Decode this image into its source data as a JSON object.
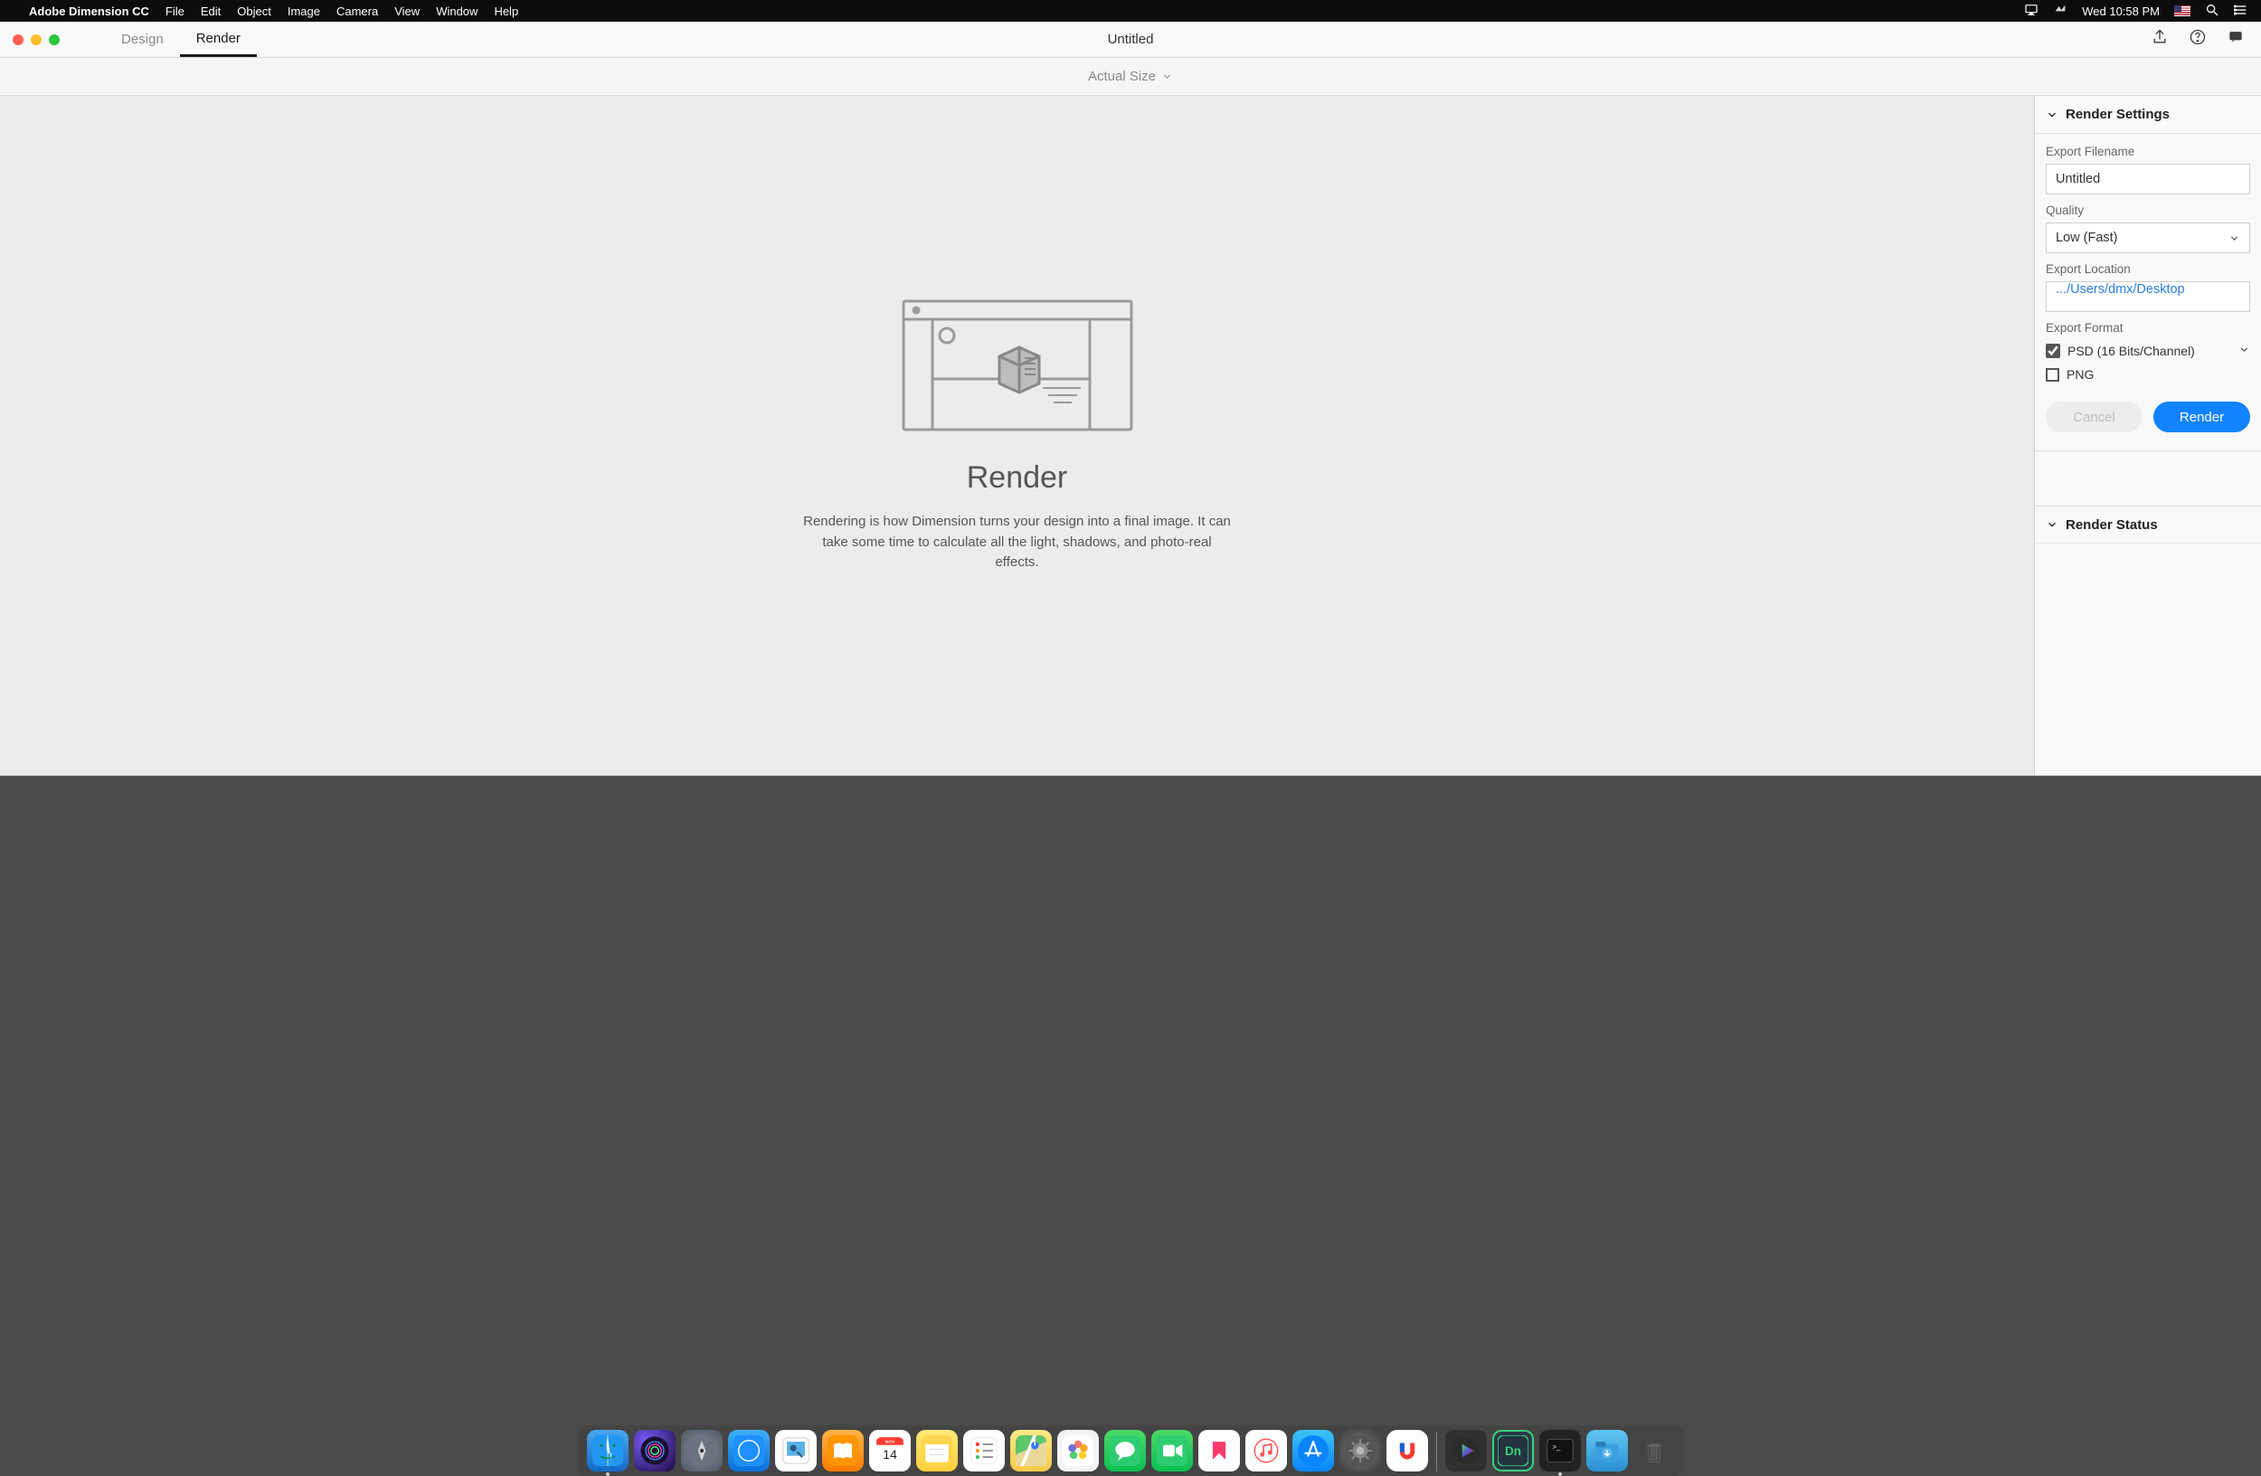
{
  "menubar": {
    "app_name": "Adobe Dimension CC",
    "items": [
      "File",
      "Edit",
      "Object",
      "Image",
      "Camera",
      "View",
      "Window",
      "Help"
    ],
    "clock": "Wed 10:58 PM"
  },
  "window": {
    "tabs": {
      "design": "Design",
      "render": "Render"
    },
    "title": "Untitled",
    "sub_toolbar": "Actual Size"
  },
  "canvas": {
    "heading": "Render",
    "description": "Rendering is how Dimension turns your design into a final image. It can take some time to calculate all the light, shadows, and photo-real effects."
  },
  "panel": {
    "settings_header": "Render Settings",
    "filename_label": "Export Filename",
    "filename_value": "Untitled",
    "quality_label": "Quality",
    "quality_value": "Low (Fast)",
    "location_label": "Export Location",
    "location_value": ".../Users/dmx/Desktop",
    "format_label": "Export Format",
    "format_psd": "PSD (16 Bits/Channel)",
    "format_png": "PNG",
    "cancel_label": "Cancel",
    "render_label": "Render",
    "status_header": "Render Status"
  },
  "dock": {
    "calendar_month": "NOV",
    "calendar_day": "14"
  }
}
